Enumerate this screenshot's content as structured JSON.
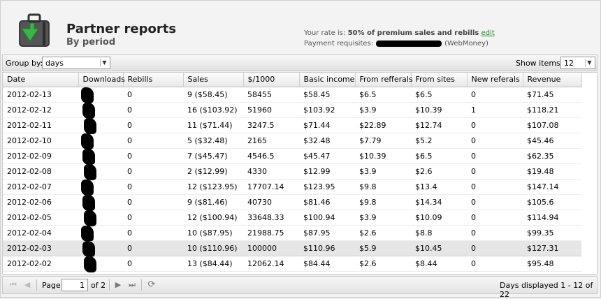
{
  "header": {
    "title": "Partner reports",
    "subtitle": "By period",
    "rate_prefix": "Your rate is:",
    "rate_value": "50% of premium sales and rebills",
    "rate_edit": "edit",
    "requisites_label": "Payment requisites:",
    "requisites_suffix": "(WebMoney)"
  },
  "toolbar": {
    "group_by_label": "Group by:",
    "group_by_value": "days",
    "show_items_label": "Show items:",
    "show_items_value": "12"
  },
  "columns": [
    "Date",
    "Downloads",
    "Rebills",
    "Sales",
    "$/1000",
    "Basic income",
    "From refferals",
    "From sites",
    "New referals",
    "Revenue"
  ],
  "rows": [
    [
      "2012-02-13",
      "0",
      "9 ($58.45)",
      "58455",
      "$58.45",
      "$6.5",
      "$6.5",
      "0",
      "$71.45"
    ],
    [
      "2012-02-12",
      "0",
      "16 ($103.92)",
      "51960",
      "$103.92",
      "$3.9",
      "$10.39",
      "1",
      "$118.21"
    ],
    [
      "2012-02-11",
      "0",
      "11 ($71.44)",
      "3247.5",
      "$71.44",
      "$22.89",
      "$12.74",
      "0",
      "$107.08"
    ],
    [
      "2012-02-10",
      "0",
      "5 ($32.48)",
      "2165",
      "$32.48",
      "$7.79",
      "$5.2",
      "0",
      "$45.46"
    ],
    [
      "2012-02-09",
      "0",
      "7 ($45.47)",
      "4546.5",
      "$45.47",
      "$10.39",
      "$6.5",
      "0",
      "$62.35"
    ],
    [
      "2012-02-08",
      "0",
      "2 ($12.99)",
      "4330",
      "$12.99",
      "$3.9",
      "$2.6",
      "0",
      "$19.48"
    ],
    [
      "2012-02-07",
      "0",
      "12 ($123.95)",
      "17707.14",
      "$123.95",
      "$9.8",
      "$13.4",
      "0",
      "$147.14"
    ],
    [
      "2012-02-06",
      "0",
      "9 ($81.46)",
      "40730",
      "$81.46",
      "$9.8",
      "$14.34",
      "0",
      "$105.6"
    ],
    [
      "2012-02-05",
      "0",
      "12 ($100.94)",
      "33648.33",
      "$100.94",
      "$3.9",
      "$10.09",
      "0",
      "$114.94"
    ],
    [
      "2012-02-04",
      "0",
      "10 ($87.95)",
      "21988.75",
      "$87.95",
      "$2.6",
      "$8.8",
      "0",
      "$99.35"
    ],
    [
      "2012-02-03",
      "0",
      "10 ($110.96)",
      "100000",
      "$110.96",
      "$5.9",
      "$10.45",
      "0",
      "$127.31"
    ],
    [
      "2012-02-02",
      "0",
      "13 ($84.44)",
      "12062.14",
      "$84.44",
      "$2.6",
      "$8.44",
      "0",
      "$95.48"
    ]
  ],
  "selected_row_index": 10,
  "pager": {
    "page_label": "Page",
    "current_page": "1",
    "of_label": "of 2",
    "status": "Days displayed 1 - 12 of 22"
  },
  "icons": {
    "first": "first-page-icon",
    "prev": "prev-page-icon",
    "next": "next-page-icon",
    "last": "last-page-icon",
    "refresh": "refresh-icon"
  },
  "colors": {
    "logo_arrow": "#39b54a",
    "edit_link": "#2a8a2a",
    "selected_row": "#e6e6e6"
  }
}
